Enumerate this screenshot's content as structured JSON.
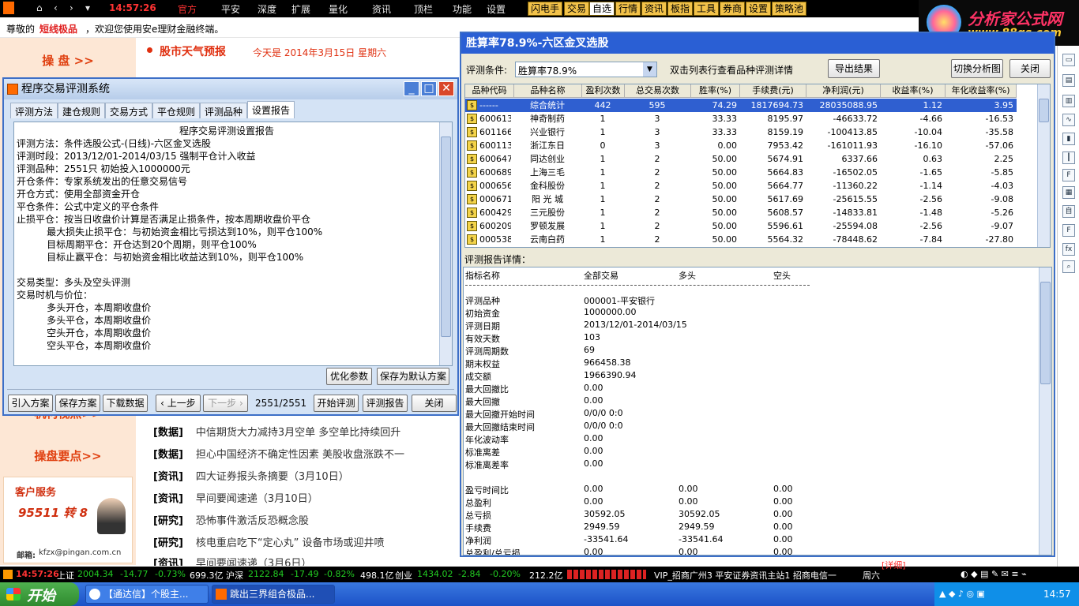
{
  "topbar": {
    "clock": "14:57:26",
    "menu": [
      "官方",
      "平安",
      "深度",
      "扩展",
      "量化",
      "资讯",
      "顶栏",
      "功能",
      "设置"
    ],
    "tools": [
      "闪电手",
      "交易",
      "自选",
      "行情",
      "资讯",
      "板指",
      "工具",
      "券商",
      "设置",
      "策略池"
    ]
  },
  "logo": {
    "line1": "分析家公式网",
    "line2": "www.88gs.com"
  },
  "welcome": {
    "prefix": "尊敬的",
    "user": "短线极品",
    "suffix": "，欢迎您使用安e理财金融终端。"
  },
  "leftnav": {
    "head1": "操 盘 >>",
    "head2": "机构视点>>",
    "head3": "操盘要点>>",
    "service_title": "客户服务",
    "hotline": "95511 转 8",
    "email_label": "邮箱:",
    "email": "kfzx@pingan.com.cn"
  },
  "weather": {
    "title": "股市天气预报",
    "date": "今天是 2014年3月15日 星期六"
  },
  "news": [
    {
      "tag": "[数据]",
      "text": "中信期货大力减持3月空单 多空单比持续回升"
    },
    {
      "tag": "[数据]",
      "text": "担心中国经济不确定性因素 美股收盘涨跌不一"
    },
    {
      "tag": "[资讯]",
      "text": "四大证券报头条摘要（3月10日）"
    },
    {
      "tag": "[资讯]",
      "text": "早间要闻速递（3月10日）"
    },
    {
      "tag": "[研究]",
      "text": "恐怖事件激活反恐概念股"
    },
    {
      "tag": "[研究]",
      "text": "核电重启吃下“定心丸” 设备市场或迎井喷"
    },
    {
      "tag": "[资讯]",
      "text": "早间要闻速递（3月6日）"
    }
  ],
  "dialog1": {
    "title": "程序交易评测系统",
    "tabs": [
      "评测方法",
      "建仓规则",
      "交易方式",
      "平仓规则",
      "评测品种",
      "设置报告"
    ],
    "report_title": "程序交易评测设置报告",
    "report_lines": [
      "评测方法：条件选股公式-(日线)-六区金叉选股",
      "评测时段：2013/12/01-2014/03/15 强制平仓计入收益",
      "评测品种：2551只 初始投入1000000元",
      "开仓条件：专家系统发出的任意交易信号",
      "开仓方式：使用全部资金开仓",
      "平仓条件：公式中定义的平仓条件",
      "止损平仓：按当日收盘价计算是否满足止损条件，按本周期收盘价平仓",
      "          最大损失止损平仓：与初始资金相比亏损达到10%，则平仓100%",
      "          目标周期平仓：开仓达到20个周期，则平仓100%",
      "          目标止赢平仓：与初始资金相比收益达到10%，则平仓100%",
      "",
      "交易类型：多头及空头评测",
      "交易时机与价位：",
      "          多头开仓，本周期收盘价",
      "          多头平仓，本周期收盘价",
      "          空头开仓，本周期收盘价",
      "          空头平仓，本周期收盘价"
    ],
    "btn_optimize": "优化参数",
    "btn_save_default": "保存为默认方案",
    "btn_import": "引入方案",
    "btn_save": "保存方案",
    "btn_download": "下载数据",
    "btn_prev": "上一步",
    "btn_next": "下一步",
    "progress": "2551/2551",
    "btn_start": "开始评测",
    "btn_report": "评测报告",
    "btn_close": "关闭"
  },
  "dialog2": {
    "title": "胜算率78.9%-六区金叉选股",
    "cond_label": "评测条件:",
    "cond_value": "胜算率78.9%",
    "hint": "双击列表行查看品种评测详情",
    "btn_export": "导出结果",
    "btn_switch": "切换分析图",
    "btn_close": "关闭",
    "columns": [
      "品种代码",
      "品种名称",
      "盈利次数",
      "总交易次数",
      "胜率(%)",
      "手续费(元)",
      "净利润(元)",
      "收益率(%)",
      "年化收益率(%)"
    ],
    "rows": [
      [
        "------",
        "综合统计",
        "442",
        "595",
        "74.29",
        "1817694.73",
        "28035088.95",
        "1.12",
        "3.95"
      ],
      [
        "600613",
        "神奇制药",
        "1",
        "3",
        "33.33",
        "8195.97",
        "-46633.72",
        "-4.66",
        "-16.53"
      ],
      [
        "601166",
        "兴业银行",
        "1",
        "3",
        "33.33",
        "8159.19",
        "-100413.85",
        "-10.04",
        "-35.58"
      ],
      [
        "600113",
        "浙江东日",
        "0",
        "3",
        "0.00",
        "7953.42",
        "-161011.93",
        "-16.10",
        "-57.06"
      ],
      [
        "600647",
        "同达创业",
        "1",
        "2",
        "50.00",
        "5674.91",
        "6337.66",
        "0.63",
        "2.25"
      ],
      [
        "600689",
        "上海三毛",
        "1",
        "2",
        "50.00",
        "5664.83",
        "-16502.05",
        "-1.65",
        "-5.85"
      ],
      [
        "000656",
        "金科股份",
        "1",
        "2",
        "50.00",
        "5664.77",
        "-11360.22",
        "-1.14",
        "-4.03"
      ],
      [
        "000671",
        "阳 光 城",
        "1",
        "2",
        "50.00",
        "5617.69",
        "-25615.55",
        "-2.56",
        "-9.08"
      ],
      [
        "600429",
        "三元股份",
        "1",
        "2",
        "50.00",
        "5608.57",
        "-14833.81",
        "-1.48",
        "-5.26"
      ],
      [
        "600209",
        "罗顿发展",
        "1",
        "2",
        "50.00",
        "5596.61",
        "-25594.08",
        "-2.56",
        "-9.07"
      ],
      [
        "000538",
        "云南白药",
        "1",
        "2",
        "50.00",
        "5564.32",
        "-78448.62",
        "-7.84",
        "-27.80"
      ]
    ],
    "detail_label": "评测报告详情：",
    "detail_headers": [
      "指标名称",
      "全部交易",
      "多头",
      "空头"
    ],
    "detail_rows1": [
      [
        "评测品种",
        "000001-平安银行"
      ],
      [
        "初始资金",
        "1000000.00"
      ],
      [
        "评测日期",
        "2013/12/01-2014/03/15"
      ],
      [
        "有效天数",
        "103"
      ],
      [
        "评测周期数",
        "69"
      ],
      [
        "期末权益",
        "966458.38"
      ],
      [
        "成交额",
        "1966390.94"
      ],
      [
        "最大回撤比",
        "0.00"
      ],
      [
        "最大回撤",
        "0.00"
      ],
      [
        "最大回撤开始时间",
        "0/0/0 0:0"
      ],
      [
        "最大回撤结束时间",
        "0/0/0 0:0"
      ],
      [
        "年化波动率",
        "0.00"
      ],
      [
        "标准离差",
        "0.00"
      ],
      [
        "标准离差率",
        "0.00"
      ]
    ],
    "detail_rows2": [
      [
        "盈亏时间比",
        "0.00",
        "0.00",
        "0.00"
      ],
      [
        "总盈利",
        "0.00",
        "0.00",
        "0.00"
      ],
      [
        "总亏损",
        "30592.05",
        "30592.05",
        "0.00"
      ],
      [
        "手续费",
        "2949.59",
        "2949.59",
        "0.00"
      ],
      [
        "净利润",
        "-33541.64",
        "-33541.64",
        "0.00"
      ],
      [
        "总盈利/总亏损",
        "0.00",
        "0.00",
        "0.00"
      ]
    ]
  },
  "status": {
    "clock": "14:57:26",
    "sh_label": "上证",
    "sh_index": "2004.34",
    "sh_chg": "-14.77",
    "sh_pct": "-0.73%",
    "sh_amt": "699.3亿",
    "sz_label": "沪深",
    "sz_index": "2122.84",
    "sz_chg": "-17.49",
    "sz_pct": "-0.82%",
    "sz_amt": "498.1亿",
    "cy_label": "创业",
    "cy_index": "1434.02",
    "cy_chg": "-2.84",
    "cy_pct": "-0.20%",
    "cy_amt": "212.2亿",
    "ticker": "VIP_招商广州3  平安证券资讯主站1  招商电信一",
    "weekday": "周六",
    "detail_link": "[详细]"
  },
  "taskbar": {
    "start": "开始",
    "task1": "【通达信】个股主...",
    "task2": "跳出三界组合极品...",
    "time": "14:57"
  }
}
